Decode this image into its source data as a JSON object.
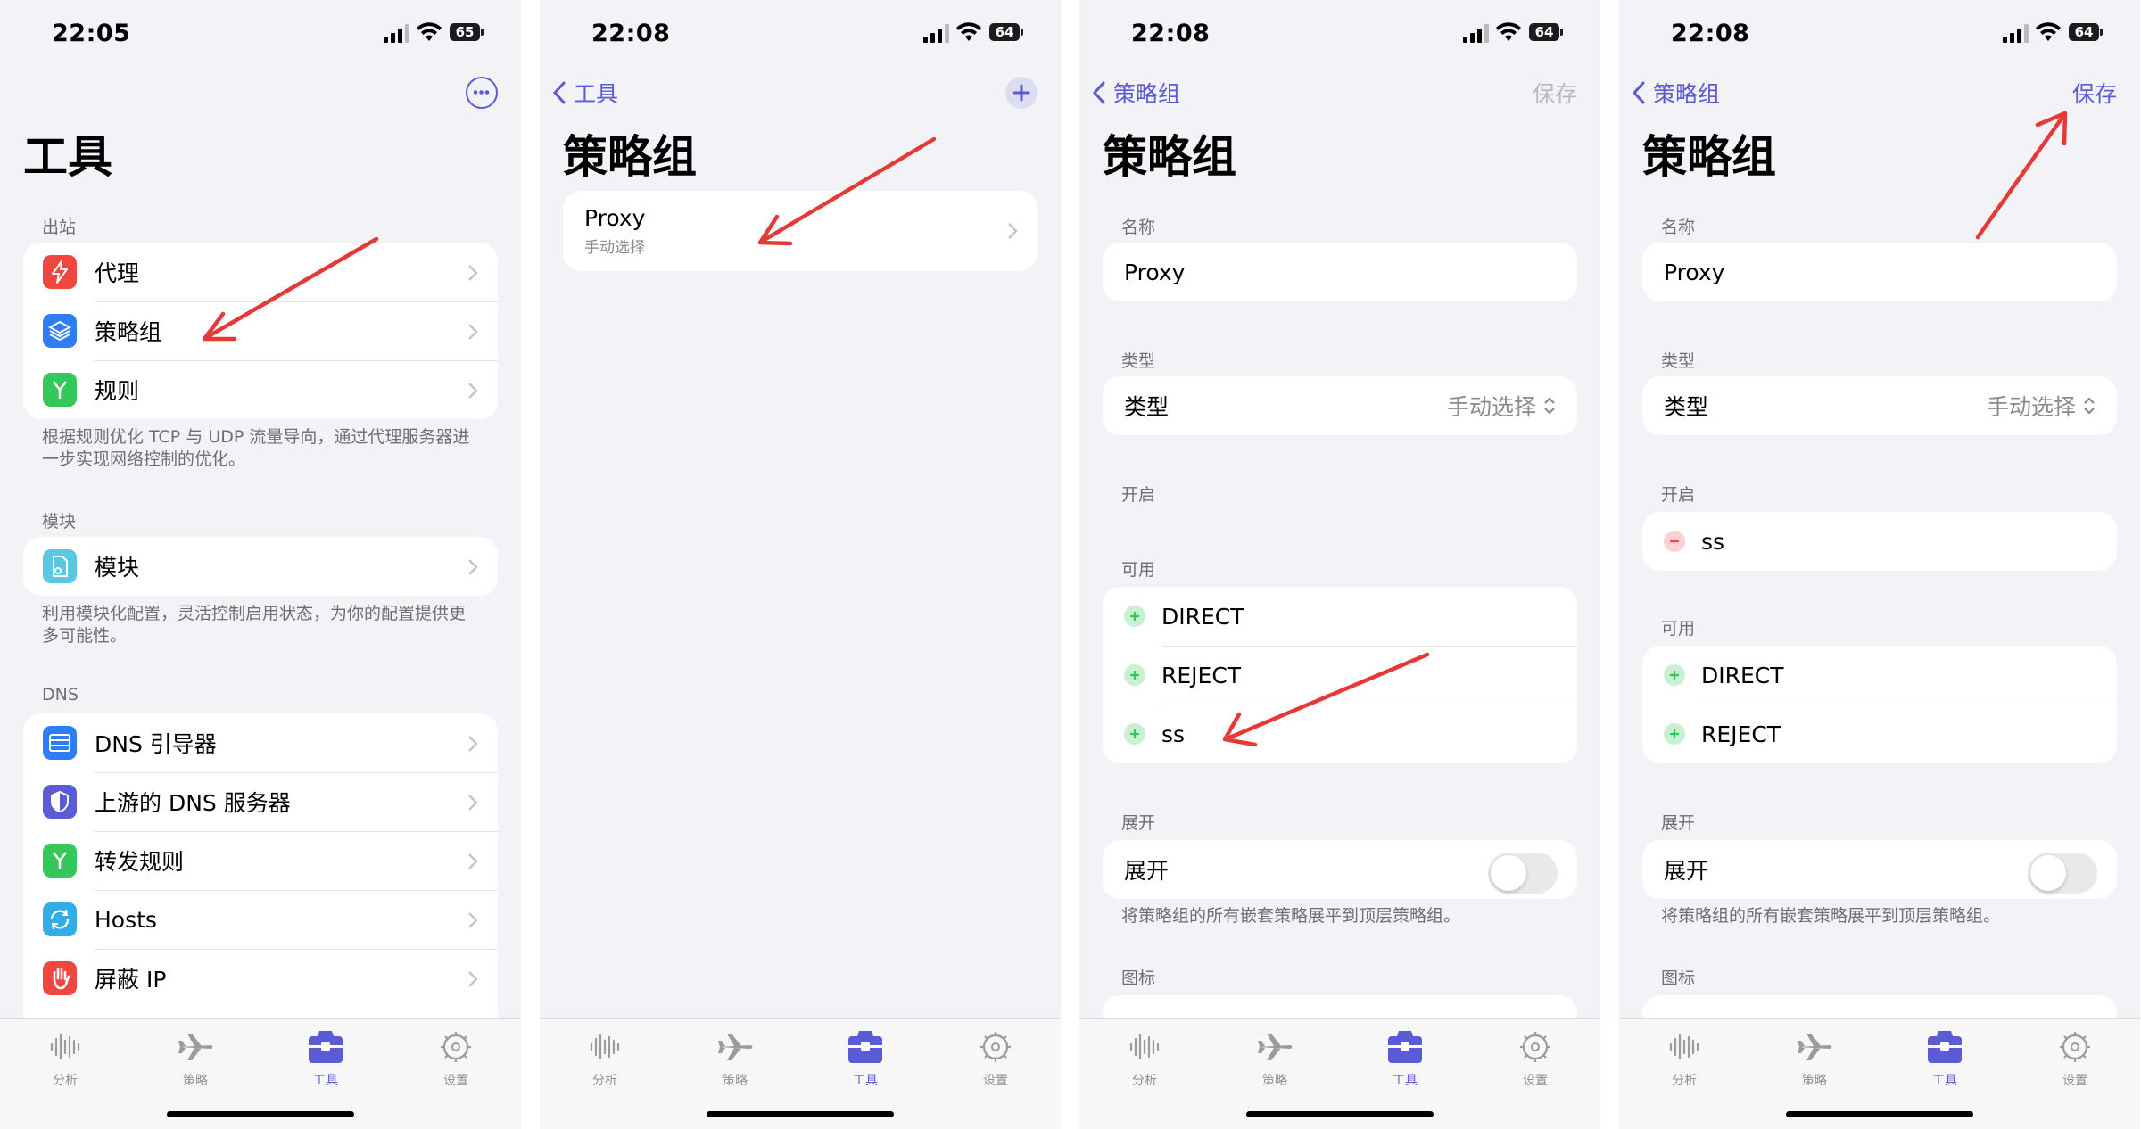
{
  "colors": {
    "accent": "#5b5bd6",
    "arrow": "#e53935",
    "bg": "#f2f2f7"
  },
  "tabs": [
    "分析",
    "策略",
    "工具",
    "设置"
  ],
  "screen1": {
    "time": "22:05",
    "battery": "65",
    "title": "工具",
    "outbound_header": "出站",
    "outbound_items": [
      {
        "label": "代理",
        "icon": "bolt-icon"
      },
      {
        "label": "策略组",
        "icon": "layers-icon"
      },
      {
        "label": "规则",
        "icon": "fork-icon"
      }
    ],
    "outbound_footer": "根据规则优化 TCP 与 UDP 流量导向，通过代理服务器进一步实现网络控制的优化。",
    "module_header": "模块",
    "module_item": "模块",
    "module_footer": "利用模块化配置，灵活控制启用状态，为你的配置提供更多可能性。",
    "dns_header": "DNS",
    "dns_items": [
      {
        "label": "DNS 引导器",
        "icon": "server-icon"
      },
      {
        "label": "上游的 DNS 服务器",
        "icon": "shield-icon"
      },
      {
        "label": "转发规则",
        "icon": "fork-icon"
      },
      {
        "label": "Hosts",
        "icon": "sync-icon"
      },
      {
        "label": "屏蔽 IP",
        "icon": "hand-icon"
      }
    ]
  },
  "screen2": {
    "time": "22:08",
    "battery": "64",
    "back": "工具",
    "title": "策略组",
    "item_name": "Proxy",
    "item_sub": "手动选择"
  },
  "screen3": {
    "time": "22:08",
    "battery": "64",
    "back": "策略组",
    "save": "保存",
    "title": "策略组",
    "name_header": "名称",
    "name_value": "Proxy",
    "type_header": "类型",
    "type_label": "类型",
    "type_value": "手动选择",
    "enabled_header": "开启",
    "available_header": "可用",
    "available": [
      "DIRECT",
      "REJECT",
      "ss"
    ],
    "expand_header": "展开",
    "expand_label": "展开",
    "expand_footer": "将策略组的所有嵌套策略展平到顶层策略组。",
    "icon_header": "图标"
  },
  "screen4": {
    "time": "22:08",
    "battery": "64",
    "back": "策略组",
    "save": "保存",
    "title": "策略组",
    "name_header": "名称",
    "name_value": "Proxy",
    "type_header": "类型",
    "type_label": "类型",
    "type_value": "手动选择",
    "enabled_header": "开启",
    "enabled": [
      "ss"
    ],
    "available_header": "可用",
    "available": [
      "DIRECT",
      "REJECT"
    ],
    "expand_header": "展开",
    "expand_label": "展开",
    "expand_footer": "将策略组的所有嵌套策略展平到顶层策略组。",
    "icon_header": "图标"
  }
}
